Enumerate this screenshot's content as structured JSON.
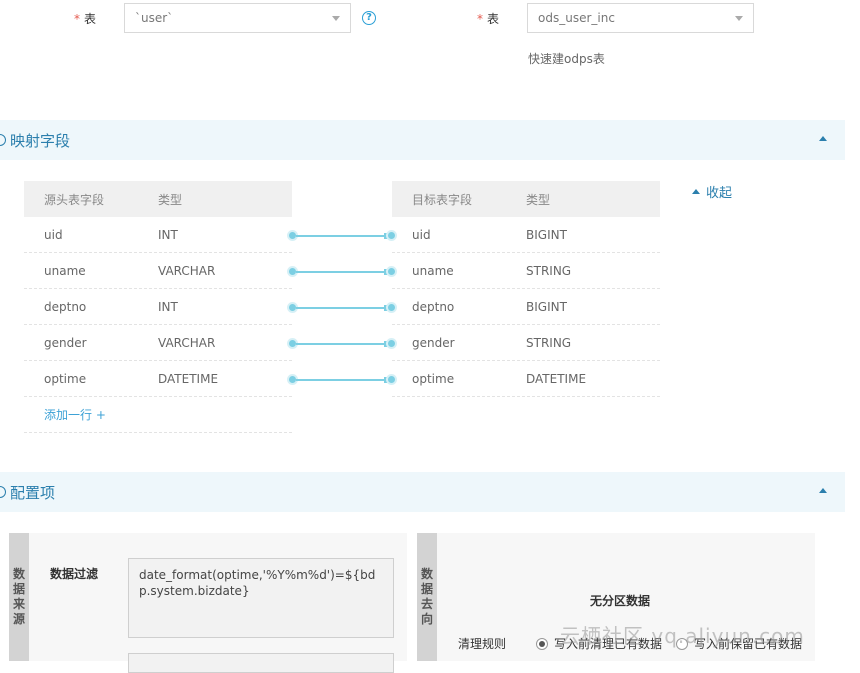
{
  "source": {
    "label": "表",
    "table_value": "`user`",
    "help_icon": "question-circle-icon"
  },
  "target": {
    "label": "表",
    "table_value": "ods_user_inc",
    "hint": "快速建odps表"
  },
  "mapping_section": {
    "title": "映射字段",
    "source_headers": [
      "源头表字段",
      "类型"
    ],
    "target_headers": [
      "目标表字段",
      "类型"
    ],
    "source_rows": [
      {
        "name": "uid",
        "type": "INT"
      },
      {
        "name": "uname",
        "type": "VARCHAR"
      },
      {
        "name": "deptno",
        "type": "INT"
      },
      {
        "name": "gender",
        "type": "VARCHAR"
      },
      {
        "name": "optime",
        "type": "DATETIME"
      }
    ],
    "target_rows": [
      {
        "name": "uid",
        "type": "BIGINT"
      },
      {
        "name": "uname",
        "type": "STRING"
      },
      {
        "name": "deptno",
        "type": "BIGINT"
      },
      {
        "name": "gender",
        "type": "STRING"
      },
      {
        "name": "optime",
        "type": "DATETIME"
      }
    ],
    "add_row_label": "添加一行 +",
    "collapse_label": "收起"
  },
  "config_section": {
    "title": "配置项",
    "source_tab": "数据来源",
    "dest_tab": "数据去向",
    "filter_label": "数据过滤",
    "filter_value": "date_format(optime,'%Y%m%d')=${bdp.system.bizdate}",
    "partition_title": "无分区数据",
    "clean_rule_label": "清理规则",
    "clean_options": [
      "写入前清理已有数据",
      "写入前保留已有数据"
    ],
    "clean_selected": 0
  },
  "watermark": "云栖社区 yq.aliyun.com",
  "colors": {
    "accent": "#2b7fad",
    "link": "#3ca1d6",
    "required": "#e45a4f",
    "section_bg": "#eef7fb"
  }
}
